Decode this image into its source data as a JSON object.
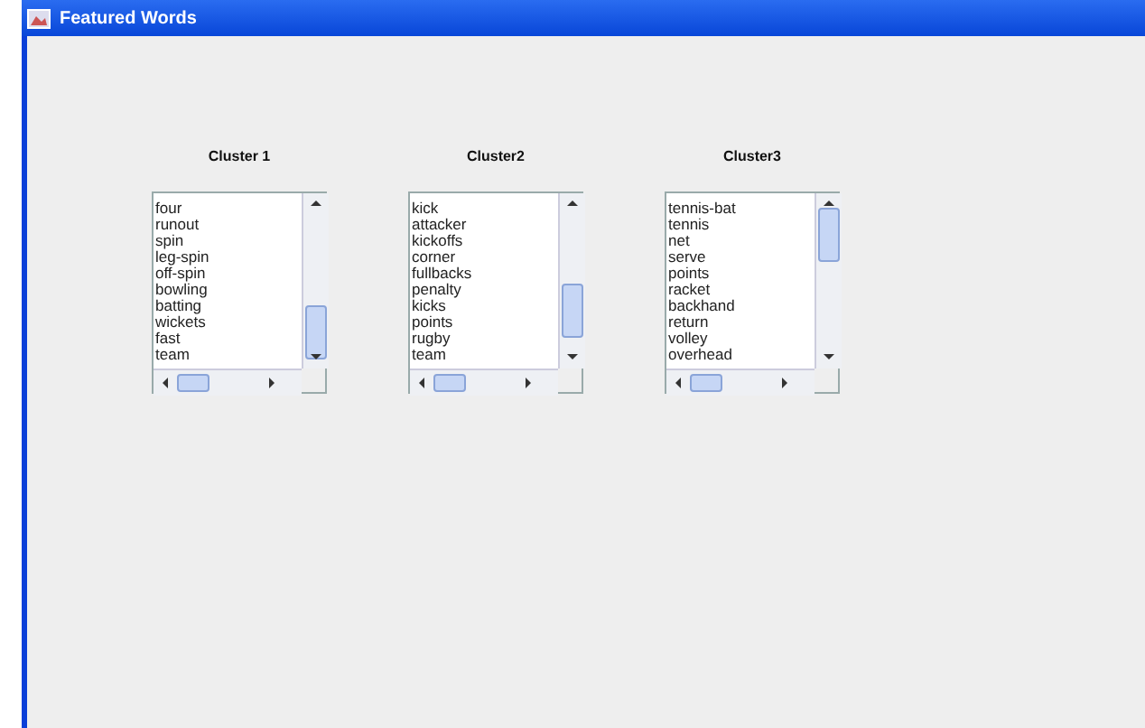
{
  "window": {
    "title": "Featured Words"
  },
  "clusters": [
    {
      "title": "Cluster 1",
      "words": [
        "four",
        "runout",
        "spin",
        "leg-spin",
        "off-spin",
        "bowling",
        "batting",
        "wickets",
        "fast",
        "team"
      ]
    },
    {
      "title": "Cluster2",
      "words": [
        "kick",
        "attacker",
        "kickoffs",
        "corner",
        "fullbacks",
        "penalty",
        "kicks",
        "points",
        "rugby",
        "team"
      ]
    },
    {
      "title": "Cluster3",
      "words": [
        "tennis-bat",
        "tennis",
        "net",
        "serve",
        "points",
        "racket",
        "backhand",
        "return",
        "volley",
        "overhead"
      ]
    }
  ]
}
